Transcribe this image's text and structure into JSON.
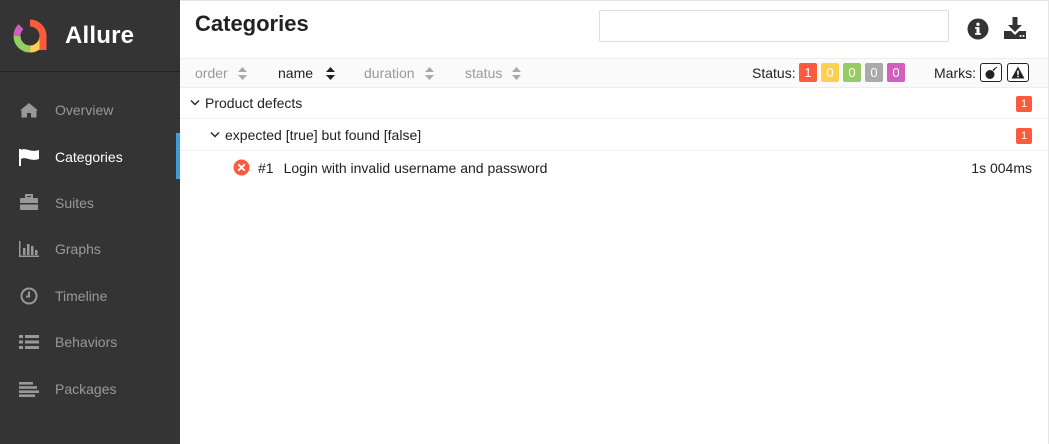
{
  "brand": {
    "name": "Allure"
  },
  "nav": [
    {
      "label": "Overview",
      "icon": "home-icon",
      "active": false
    },
    {
      "label": "Categories",
      "icon": "flag-icon",
      "active": true
    },
    {
      "label": "Suites",
      "icon": "briefcase-icon",
      "active": false
    },
    {
      "label": "Graphs",
      "icon": "bar-chart-icon",
      "active": false
    },
    {
      "label": "Timeline",
      "icon": "clock-icon",
      "active": false
    },
    {
      "label": "Behaviors",
      "icon": "list-icon",
      "active": false
    },
    {
      "label": "Packages",
      "icon": "align-left-icon",
      "active": false
    }
  ],
  "header": {
    "title": "Categories",
    "search_value": ""
  },
  "sort": [
    {
      "label": "order",
      "active": false
    },
    {
      "label": "name",
      "active": true
    },
    {
      "label": "duration",
      "active": false
    },
    {
      "label": "status",
      "active": false
    }
  ],
  "status_filter": {
    "label": "Status:",
    "counts": [
      {
        "status": "failed",
        "value": "1",
        "color": "#fd5a3e"
      },
      {
        "status": "broken",
        "value": "0",
        "color": "#ffd050"
      },
      {
        "status": "passed",
        "value": "0",
        "color": "#97cc64"
      },
      {
        "status": "skipped",
        "value": "0",
        "color": "#aaaaaa"
      },
      {
        "status": "unknown",
        "value": "0",
        "color": "#d35ebe"
      }
    ]
  },
  "marks": {
    "label": "Marks:",
    "items": [
      "flaky-bomb-icon",
      "warning-triangle-icon"
    ]
  },
  "tree": {
    "category": {
      "label": "Product defects",
      "count": "1"
    },
    "subcategory": {
      "label": "expected [true] but found [false]",
      "count": "1"
    },
    "test_case": {
      "number": "#1",
      "name": "Login with invalid username and password",
      "duration": "1s 004ms",
      "status": "failed"
    }
  },
  "colors": {
    "sidebar": "#343434",
    "accent": "#3d9ddb",
    "failed": "#fd5a3e"
  }
}
